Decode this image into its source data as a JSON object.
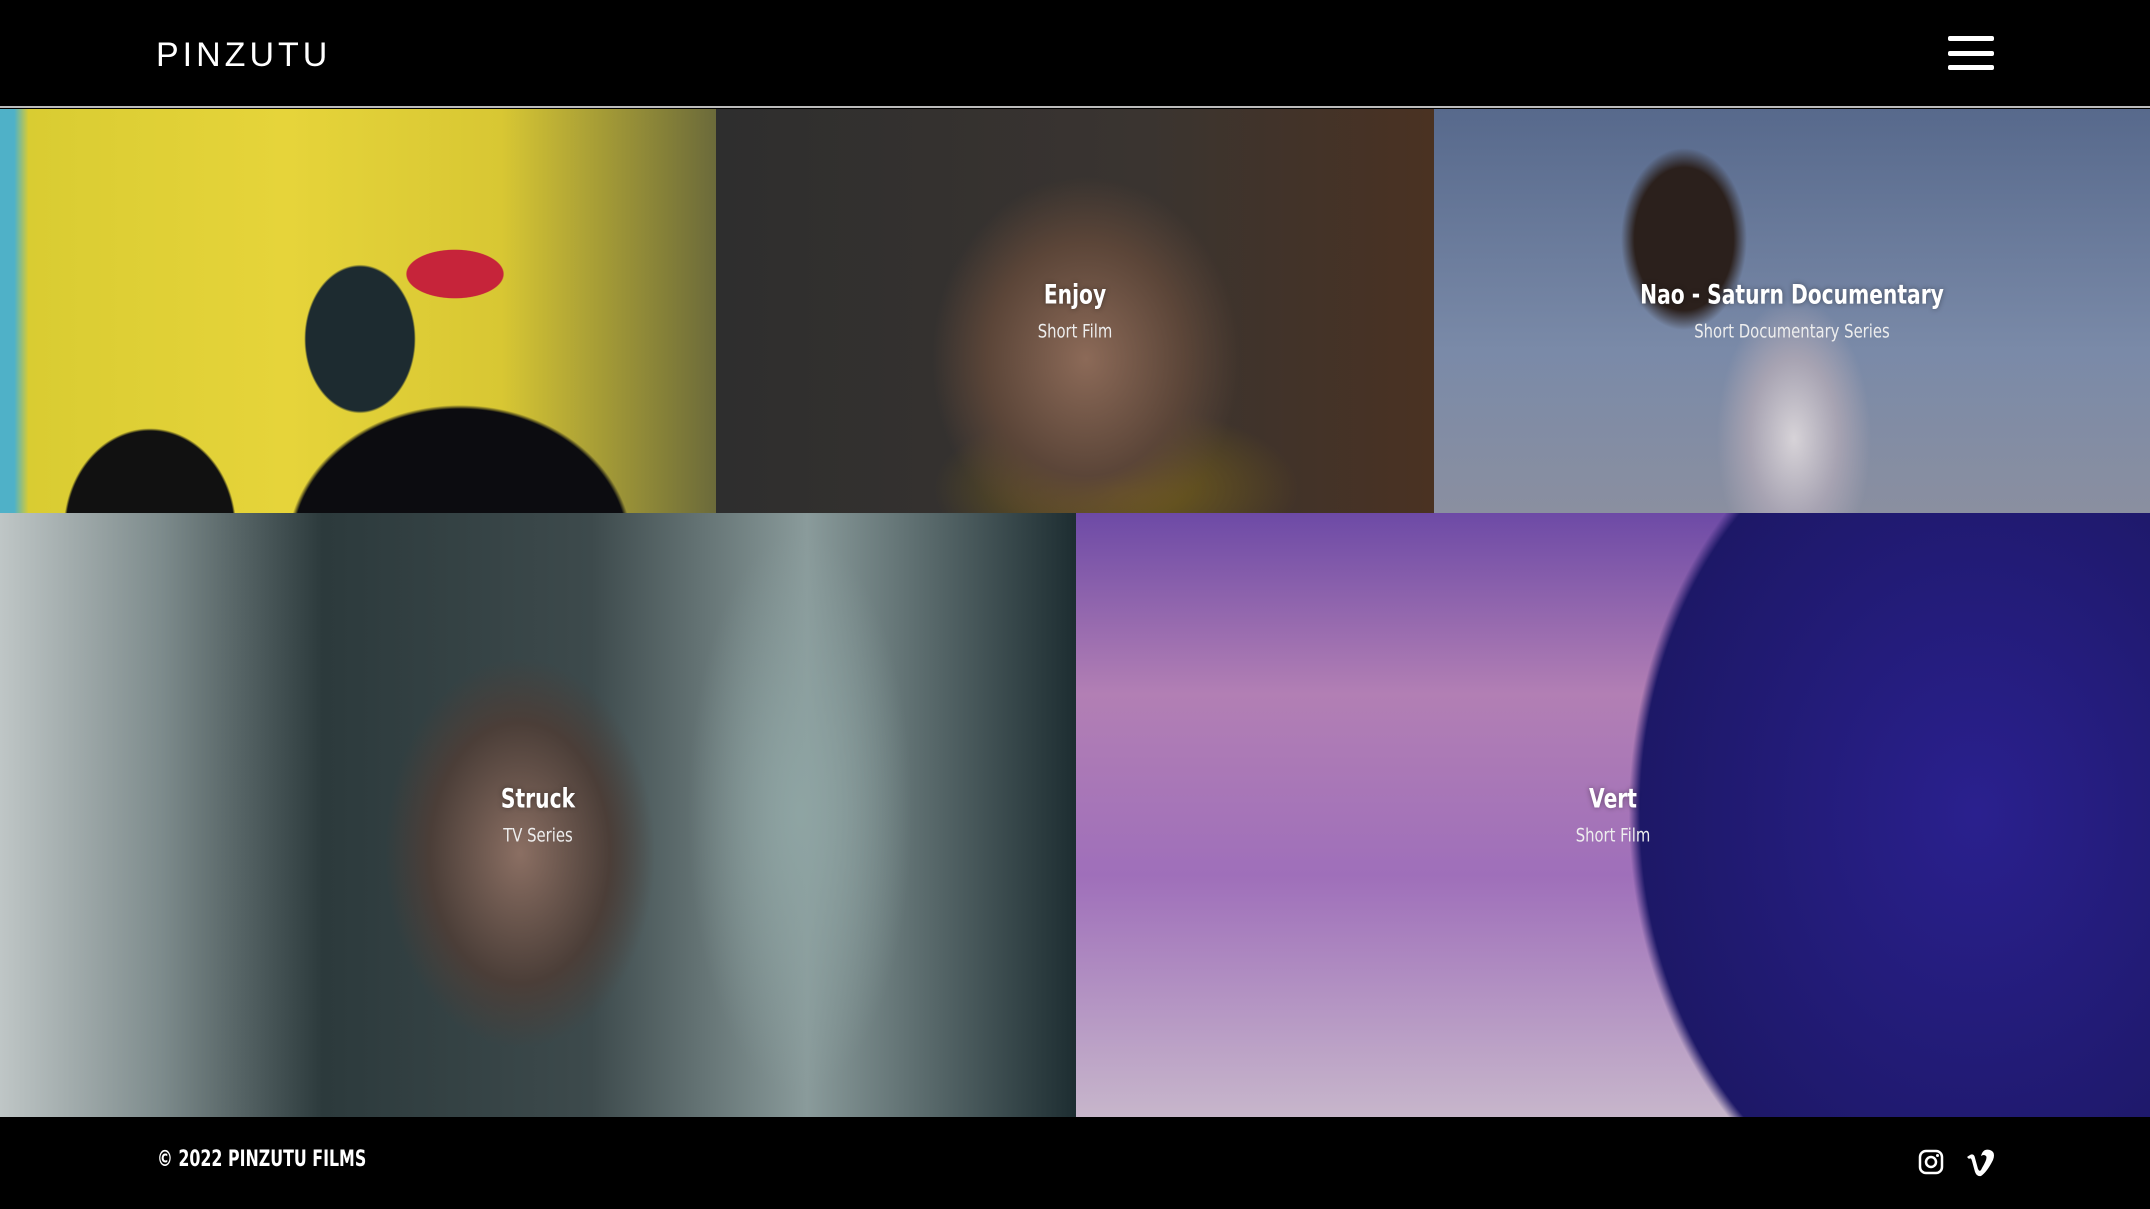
{
  "header": {
    "logo": "PINZUTU",
    "menu_icon": "hamburger-icon"
  },
  "projects": [
    {
      "title": "",
      "subtitle": ""
    },
    {
      "title": "Enjoy",
      "subtitle": "Short Film"
    },
    {
      "title": "Nao - Saturn Documentary",
      "subtitle": "Short Documentary Series"
    },
    {
      "title": "Struck",
      "subtitle": "TV Series"
    },
    {
      "title": "Vert",
      "subtitle": "Short Film"
    }
  ],
  "footer": {
    "copyright": "© 2022 PINZUTU FILMS",
    "social": [
      "instagram-icon",
      "vimeo-icon"
    ]
  }
}
